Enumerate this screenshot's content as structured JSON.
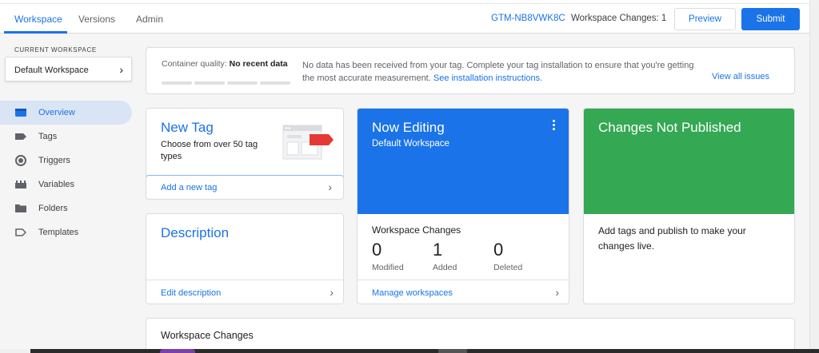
{
  "header": {
    "tabs": [
      {
        "label": "Workspace",
        "active": true
      },
      {
        "label": "Versions",
        "active": false
      },
      {
        "label": "Admin",
        "active": false
      }
    ],
    "container_id": "GTM-NB8VWK8C",
    "workspace_changes": "Workspace Changes: 1",
    "preview_label": "Preview",
    "submit_label": "Submit"
  },
  "sidebar": {
    "current_workspace_label": "CURRENT WORKSPACE",
    "workspace_name": "Default Workspace",
    "items": [
      {
        "label": "Overview",
        "icon": "overview-icon",
        "active": true
      },
      {
        "label": "Tags",
        "icon": "tag-icon"
      },
      {
        "label": "Triggers",
        "icon": "trigger-icon"
      },
      {
        "label": "Variables",
        "icon": "variables-icon"
      },
      {
        "label": "Folders",
        "icon": "folder-icon"
      },
      {
        "label": "Templates",
        "icon": "template-icon"
      }
    ]
  },
  "quality": {
    "label": "Container quality:",
    "value": "No recent data",
    "message": "No data has been received from your tag. Complete your tag installation to ensure that you're getting the most accurate measurement.",
    "instructions_link": "See installation instructions.",
    "view_issues": "View all issues"
  },
  "new_tag": {
    "title": "New Tag",
    "description": "Choose from over 50 tag types",
    "action": "Add a new tag"
  },
  "description_card": {
    "title": "Description",
    "action": "Edit description"
  },
  "now_editing": {
    "title": "Now Editing",
    "workspace": "Default Workspace",
    "section_title": "Workspace Changes",
    "stats": [
      {
        "value": "0",
        "label": "Modified"
      },
      {
        "value": "1",
        "label": "Added"
      },
      {
        "value": "0",
        "label": "Deleted"
      }
    ],
    "action": "Manage workspaces"
  },
  "not_published": {
    "title": "Changes Not Published",
    "message": "Add tags and publish to make your changes live."
  },
  "workspace_changes_panel": {
    "title": "Workspace Changes"
  },
  "colors": {
    "accent": "#1a73e8",
    "green": "#34a853",
    "nav_active": "#d9e5f5"
  }
}
